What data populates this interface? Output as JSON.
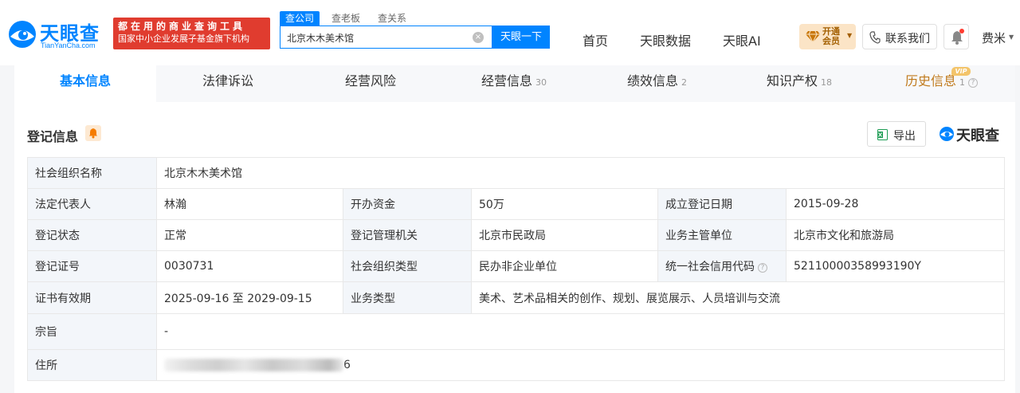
{
  "header": {
    "logo_name": "天眼查",
    "logo_domain": "TianYanCha.com",
    "promo_line1": "都在用的商业查询工具",
    "promo_line2": "国家中小企业发展子基金旗下机构",
    "search_tabs": [
      "查公司",
      "查老板",
      "查关系"
    ],
    "search_value": "北京木木美术馆",
    "search_button": "天眼一下",
    "nav": [
      "首页",
      "天眼数据",
      "天眼AI"
    ],
    "vip_label": "开通会员",
    "contact_label": "联系我们",
    "user_name": "费米"
  },
  "tabs": [
    {
      "label": "基本信息",
      "count": ""
    },
    {
      "label": "法律诉讼",
      "count": ""
    },
    {
      "label": "经营风险",
      "count": ""
    },
    {
      "label": "经营信息",
      "count": "30"
    },
    {
      "label": "绩效信息",
      "count": "2"
    },
    {
      "label": "知识产权",
      "count": "18"
    },
    {
      "label": "历史信息",
      "count": "1",
      "badge": "VIP"
    }
  ],
  "section": {
    "title": "登记信息",
    "export_label": "导出",
    "watermark": "天眼查"
  },
  "registration": {
    "org_name_label": "社会组织名称",
    "org_name": "北京木木美术馆",
    "legal_rep_label": "法定代表人",
    "legal_rep": "林瀚",
    "capital_label": "开办资金",
    "capital": "50万",
    "reg_date_label": "成立登记日期",
    "reg_date": "2015-09-28",
    "status_label": "登记状态",
    "status": "正常",
    "authority_label": "登记管理机关",
    "authority": "北京市民政局",
    "supervisor_label": "业务主管单位",
    "supervisor": "北京市文化和旅游局",
    "cert_no_label": "登记证号",
    "cert_no": "0030731",
    "org_type_label": "社会组织类型",
    "org_type": "民办非企业单位",
    "credit_code_label": "统一社会信用代码",
    "credit_code": "52110000358993190Y",
    "validity_label": "证书有效期",
    "validity": "2025-09-16 至 2029-09-15",
    "business_label": "业务类型",
    "business": "美术、艺术品相关的创作、规划、展览展示、人员培训与交流",
    "purpose_label": "宗旨",
    "purpose": "-",
    "address_label": "住所",
    "address_tail": "6"
  },
  "colors": {
    "brand_blue": "#0084ff",
    "promo_red": "#e03c2f",
    "status_green": "#1a9e3f",
    "vip_gold": "#c07a1c"
  }
}
